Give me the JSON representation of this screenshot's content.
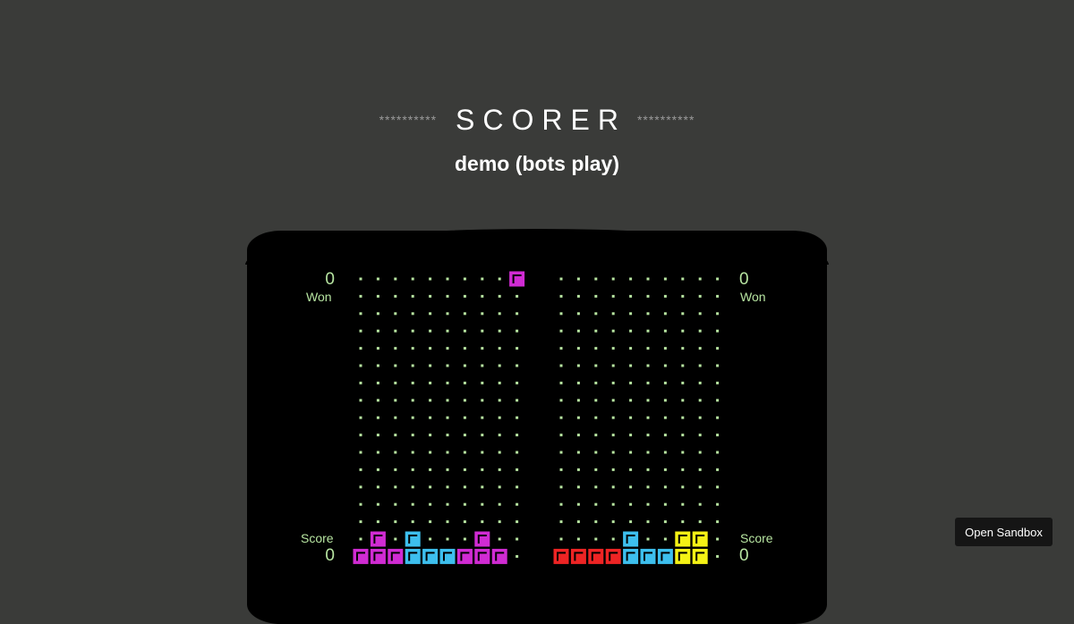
{
  "header": {
    "stars_left": "**********",
    "title": "SCORER",
    "stars_right": "**********",
    "subtitle": "demo (bots play)"
  },
  "players": [
    {
      "won_count": "0",
      "won_label": "Won",
      "score_label": "Score",
      "score_value": "0"
    },
    {
      "won_count": "0",
      "won_label": "Won",
      "score_label": "Score",
      "score_value": "0"
    }
  ],
  "colors": {
    "magenta": "#d02bd3",
    "cyan": "#3dbfee",
    "red": "#ee2424",
    "yellow": "#f5f215",
    "grid_dot": "#b7e5a1"
  },
  "boards": [
    {
      "rows": 17,
      "cols": 10,
      "blocks": [
        {
          "row": 0,
          "col": 9,
          "color": "magenta"
        },
        {
          "row": 15,
          "col": 1,
          "color": "magenta"
        },
        {
          "row": 15,
          "col": 3,
          "color": "cyan"
        },
        {
          "row": 15,
          "col": 7,
          "color": "magenta"
        },
        {
          "row": 16,
          "col": 0,
          "color": "magenta"
        },
        {
          "row": 16,
          "col": 1,
          "color": "magenta"
        },
        {
          "row": 16,
          "col": 2,
          "color": "magenta"
        },
        {
          "row": 16,
          "col": 3,
          "color": "cyan"
        },
        {
          "row": 16,
          "col": 4,
          "color": "cyan"
        },
        {
          "row": 16,
          "col": 5,
          "color": "cyan"
        },
        {
          "row": 16,
          "col": 6,
          "color": "magenta"
        },
        {
          "row": 16,
          "col": 7,
          "color": "magenta"
        },
        {
          "row": 16,
          "col": 8,
          "color": "magenta"
        }
      ]
    },
    {
      "rows": 17,
      "cols": 10,
      "blocks": [
        {
          "row": 15,
          "col": 4,
          "color": "cyan"
        },
        {
          "row": 15,
          "col": 7,
          "color": "yellow"
        },
        {
          "row": 15,
          "col": 8,
          "color": "yellow"
        },
        {
          "row": 16,
          "col": 0,
          "color": "red"
        },
        {
          "row": 16,
          "col": 1,
          "color": "red"
        },
        {
          "row": 16,
          "col": 2,
          "color": "red"
        },
        {
          "row": 16,
          "col": 3,
          "color": "red"
        },
        {
          "row": 16,
          "col": 4,
          "color": "cyan"
        },
        {
          "row": 16,
          "col": 5,
          "color": "cyan"
        },
        {
          "row": 16,
          "col": 6,
          "color": "cyan"
        },
        {
          "row": 16,
          "col": 7,
          "color": "yellow"
        },
        {
          "row": 16,
          "col": 8,
          "color": "yellow"
        }
      ]
    }
  ],
  "sandbox_button": "Open Sandbox"
}
